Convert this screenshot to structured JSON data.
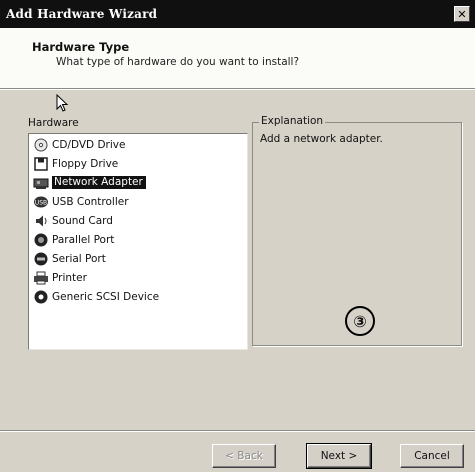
{
  "window": {
    "title": "Add Hardware Wizard",
    "close_glyph": "✕"
  },
  "header": {
    "title": "Hardware Type",
    "subtitle": "What type of hardware do you want to install?"
  },
  "hardware_list": {
    "label": "Hardware",
    "items": [
      {
        "label": "CD/DVD Drive",
        "icon": "cd-drive-icon"
      },
      {
        "label": "Floppy Drive",
        "icon": "floppy-icon"
      },
      {
        "label": "Network Adapter",
        "icon": "network-adapter-icon",
        "selected": true
      },
      {
        "label": "USB Controller",
        "icon": "usb-icon"
      },
      {
        "label": "Sound Card",
        "icon": "sound-icon"
      },
      {
        "label": "Parallel Port",
        "icon": "parallel-port-icon"
      },
      {
        "label": "Serial Port",
        "icon": "serial-port-icon"
      },
      {
        "label": "Printer",
        "icon": "printer-icon"
      },
      {
        "label": "Generic SCSI Device",
        "icon": "scsi-icon"
      }
    ]
  },
  "explanation": {
    "label": "Explanation",
    "text": "Add a network adapter."
  },
  "annotation": {
    "step": "③"
  },
  "buttons": {
    "back": "< Back",
    "next": "Next >",
    "cancel": "Cancel"
  }
}
